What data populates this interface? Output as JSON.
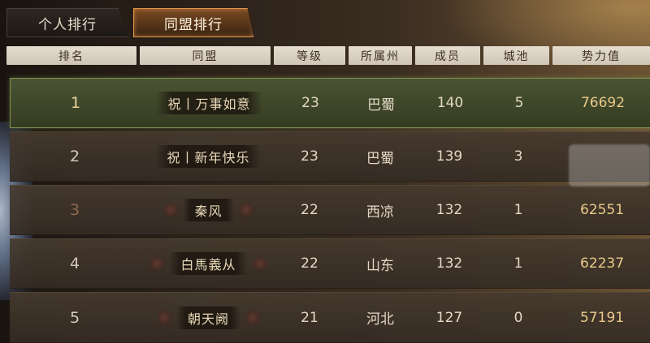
{
  "tabs": [
    {
      "label": "个人排行",
      "active": false
    },
    {
      "label": "同盟排行",
      "active": true
    }
  ],
  "columns": [
    "排名",
    "同盟",
    "等级",
    "所属州",
    "成员",
    "城池",
    "势力值"
  ],
  "rows": [
    {
      "rank": "1",
      "alliance": "祝丨万事如意",
      "level": "23",
      "region": "巴蜀",
      "members": "140",
      "cities": "5",
      "power": "76692"
    },
    {
      "rank": "2",
      "alliance": "祝丨新年快乐",
      "level": "23",
      "region": "巴蜀",
      "members": "139",
      "cities": "3",
      "power": ""
    },
    {
      "rank": "3",
      "alliance": "秦风",
      "level": "22",
      "region": "西凉",
      "members": "132",
      "cities": "1",
      "power": "62551"
    },
    {
      "rank": "4",
      "alliance": "白馬義从",
      "level": "22",
      "region": "山东",
      "members": "132",
      "cities": "1",
      "power": "62237"
    },
    {
      "rank": "5",
      "alliance": "朝天阙",
      "level": "21",
      "region": "河北",
      "members": "127",
      "cities": "0",
      "power": "57191"
    }
  ],
  "colors": {
    "accent_tab_border": "#e0954a",
    "highlight_row": "#4a5432",
    "power_text": "#e8c98a"
  }
}
